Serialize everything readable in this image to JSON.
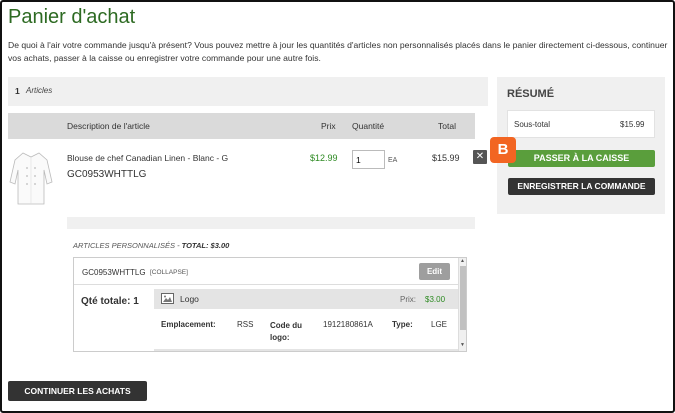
{
  "page": {
    "title": "Panier d'achat",
    "intro": "De quoi à l'air votre commande jusqu'à présent? Vous pouvez mettre à jour les quantités d'articles non personnalisés placés dans le panier directement ci-dessous, continuer vos achats, passer à la caisse ou enregistrer votre commande pour une autre fois."
  },
  "cart": {
    "count": "1",
    "count_label": "Articles",
    "columns": {
      "description": "Description de l'article",
      "price": "Prix",
      "quantity": "Quantité",
      "total": "Total"
    },
    "item": {
      "name": "Blouse de chef Canadian Linen - Blanc - G",
      "sku": "GC0953WHTTLG",
      "price": "$12.99",
      "quantity": "1",
      "unit": "EA",
      "total": "$15.99",
      "remove_symbol": "✕"
    }
  },
  "personalization": {
    "title": "ARTICLES PERSONNALISÉS - ",
    "total": "TOTAL: $3.00",
    "sku": "GC0953WHTTLG",
    "collapse": "[COLLAPSE]",
    "edit": "Edit",
    "qty_total": "Qté totale: 1",
    "logo_label": "Logo",
    "prix_label": "Prix:",
    "prix_value": "$3.00",
    "emplacement_label": "Emplacement:",
    "emplacement_value": "RSS",
    "code_label": "Code du logo:",
    "code_value": "1912180861A",
    "type_label": "Type:",
    "type_value": "LGE"
  },
  "summary": {
    "title": "RÉSUMÉ",
    "subtotal_label": "Sous-total",
    "subtotal_value": "$15.99",
    "checkout": "PASSER À LA CAISSE",
    "save_order": "ENREGISTRER LA COMMANDE"
  },
  "annotation": {
    "badge": "B"
  },
  "footer": {
    "continue": "CONTINUER LES ACHATS"
  }
}
